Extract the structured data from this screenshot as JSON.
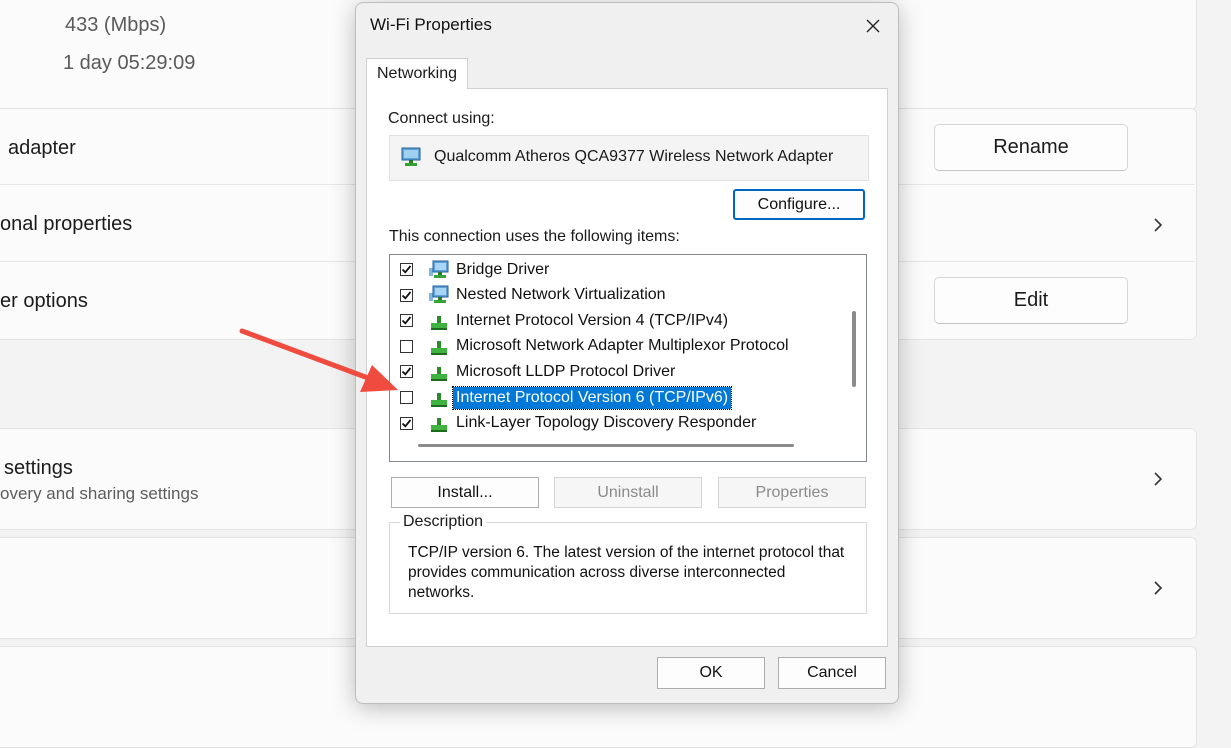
{
  "background": {
    "speed": "433 (Mbps)",
    "duration": "1 day 05:29:09",
    "rows": {
      "adapter_label": "adapter",
      "properties_label": "onal properties",
      "options_label": "er options",
      "settings_title": "settings",
      "settings_sub": "overy and sharing settings"
    },
    "rename_button": "Rename",
    "edit_button": "Edit"
  },
  "dialog": {
    "title": "Wi-Fi Properties",
    "tab": "Networking",
    "connect_using_label": "Connect using:",
    "adapter_name": "Qualcomm Atheros QCA9377 Wireless Network Adapter",
    "configure_button": "Configure...",
    "items_label": "This connection uses the following items:",
    "items": [
      {
        "label": "Bridge Driver",
        "checked": true,
        "icon": "network-adapter-icon"
      },
      {
        "label": "Nested Network Virtualization",
        "checked": true,
        "icon": "network-adapter-icon"
      },
      {
        "label": "Internet Protocol Version 4 (TCP/IPv4)",
        "checked": true,
        "icon": "protocol-icon"
      },
      {
        "label": "Microsoft Network Adapter Multiplexor Protocol",
        "checked": false,
        "icon": "protocol-icon"
      },
      {
        "label": "Microsoft LLDP Protocol Driver",
        "checked": true,
        "icon": "protocol-icon"
      },
      {
        "label": "Internet Protocol Version 6 (TCP/IPv6)",
        "checked": false,
        "icon": "protocol-icon",
        "selected": true
      },
      {
        "label": "Link-Layer Topology Discovery Responder",
        "checked": true,
        "icon": "protocol-icon"
      }
    ],
    "install_button": "Install...",
    "uninstall_button": "Uninstall",
    "properties_button": "Properties",
    "description_title": "Description",
    "description_text": "TCP/IP version 6. The latest version of the internet protocol that provides communication across diverse interconnected networks.",
    "ok_button": "OK",
    "cancel_button": "Cancel"
  },
  "colors": {
    "selection": "#0078d7",
    "annotation_arrow": "#ef4b3f",
    "primary_border": "#0067c0"
  }
}
